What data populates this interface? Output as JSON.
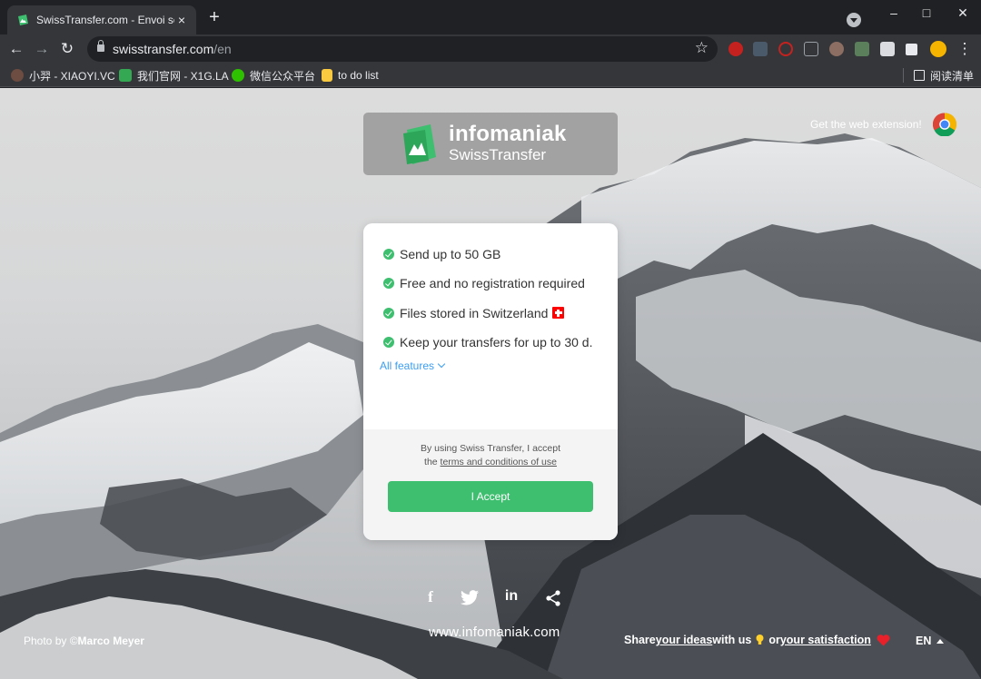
{
  "browser": {
    "tab": {
      "title": "SwissTransfer.com - Envoi séc",
      "close": "×"
    },
    "new_tab": "+",
    "window_controls": {
      "minimize": "–",
      "maximize": "□",
      "close": "✕"
    },
    "nav": {
      "back": "←",
      "forward": "→",
      "reload": "↻"
    },
    "url": {
      "domain": "swisstransfer.com",
      "path": "/en"
    },
    "bookmark_star": "☆",
    "extensions": [
      "adblock-icon",
      "dots-icon",
      "opera-icon",
      "copy-icon",
      "hand-icon",
      "folder-icon",
      "image-icon",
      "puzzle-icon",
      "avatar",
      "menu-icon"
    ],
    "menu": "⋮",
    "bookmarks": [
      {
        "label": "小羿 - XIAOYI.VC",
        "icon": "avatar-icon"
      },
      {
        "label": "我们官网 - X1G.LA",
        "icon": "site-icon"
      },
      {
        "label": "微信公众平台",
        "icon": "wechat-icon"
      },
      {
        "label": "to do list",
        "icon": "folder-icon"
      }
    ],
    "reading_list": "阅读清单"
  },
  "logo": {
    "brand": "infomaniak",
    "product": "SwissTransfer"
  },
  "extension_link": "Get the web extension!",
  "features": [
    "Send up to 50 GB",
    "Free and no registration required",
    "Files stored in Switzerland",
    "Keep your transfers for up to 30 d."
  ],
  "all_features": "All features",
  "terms": {
    "line1": "By using Swiss Transfer, I accept",
    "line2_prefix": "the ",
    "link": "terms and conditions of use"
  },
  "accept_button": "I Accept",
  "social": {
    "facebook": "f",
    "linkedin": "in"
  },
  "footer": {
    "domain": "www.infomaniak.com",
    "credit_prefix": "Photo by ©",
    "credit_name": "Marco Meyer",
    "share_prefix": "Share ",
    "share_link1": "your ideas",
    "share_middle": " with us",
    "share_or": " or ",
    "share_link2": "your satisfaction",
    "language": "EN"
  },
  "colors": {
    "accent_green": "#3ebf6f",
    "link_blue": "#3b9ef3",
    "chrome_dark": "#202124",
    "chrome_toolbar": "#35363a"
  }
}
